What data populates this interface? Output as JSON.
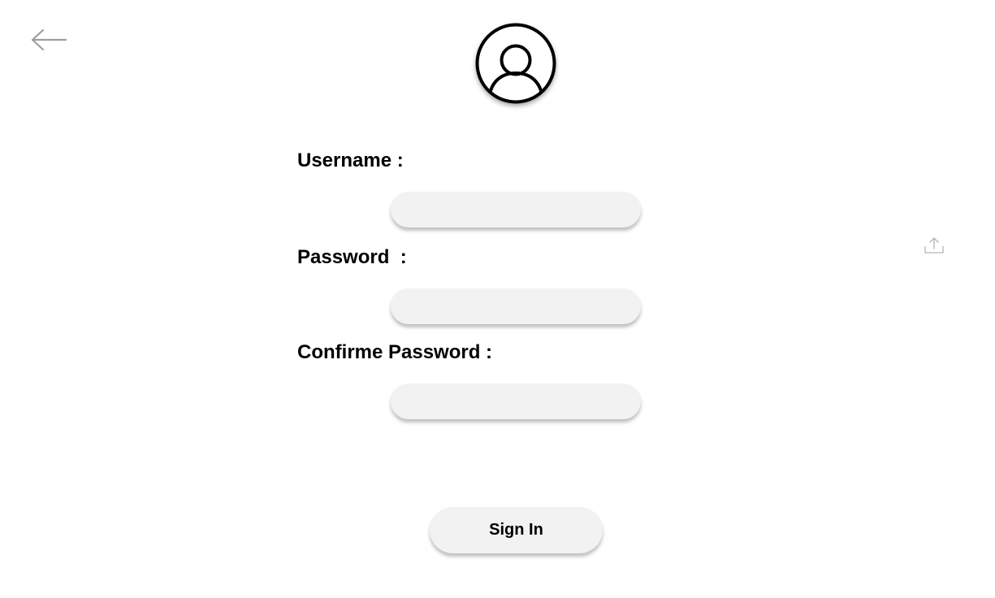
{
  "header": {
    "back_icon": "arrow-left-icon",
    "avatar_icon": "user-circle-icon"
  },
  "form": {
    "username_label": "Username :",
    "username_value": "",
    "password_label": "Password  :",
    "password_value": "",
    "confirm_label": "Confirme Password :",
    "confirm_value": "",
    "submit_label": "Sign In"
  },
  "side": {
    "upload_icon": "upload-icon"
  },
  "colors": {
    "background": "#ffffff",
    "field_bg": "#f2f2f2",
    "text": "#000000",
    "icon_grey": "#9e9e9e"
  }
}
